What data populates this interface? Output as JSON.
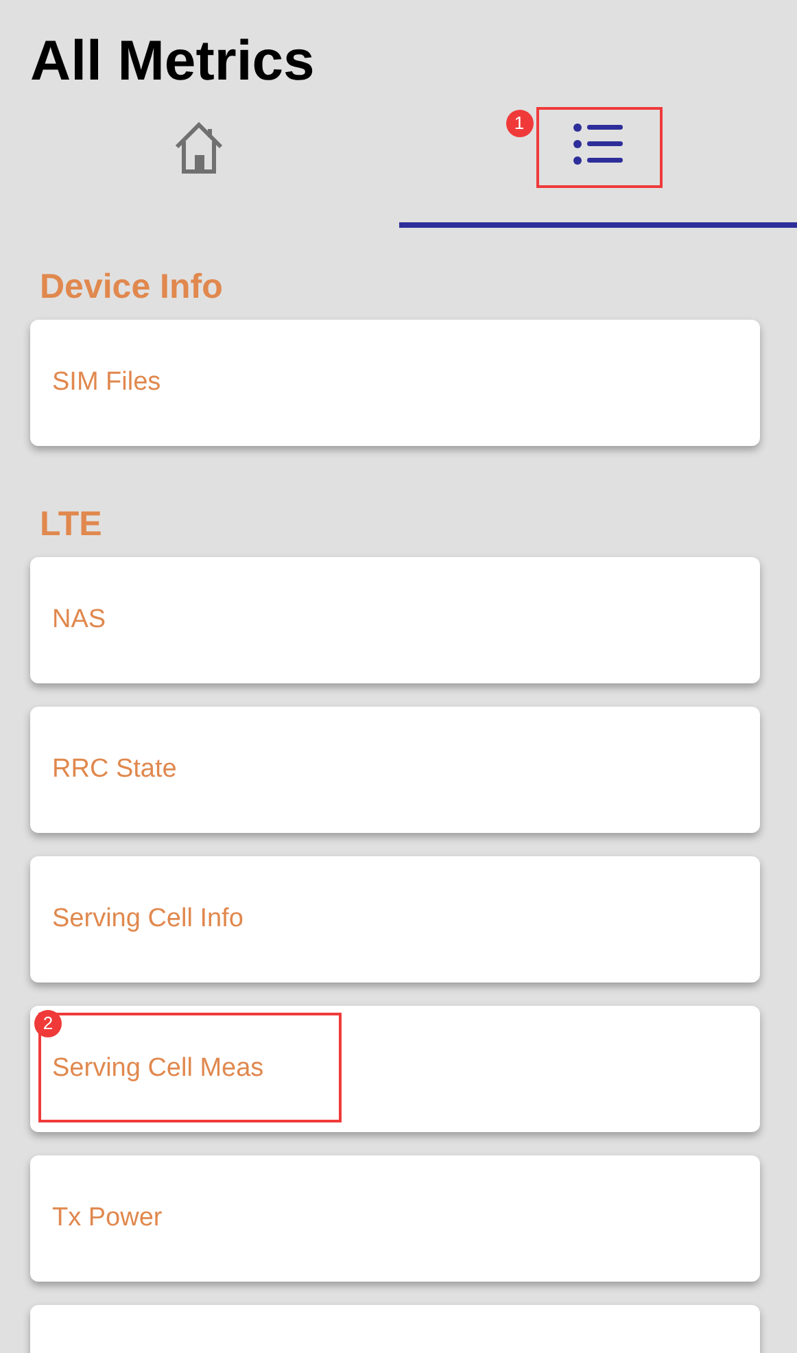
{
  "title": "All Metrics",
  "tabs": [
    {
      "kind": "home",
      "selected": false
    },
    {
      "kind": "list",
      "selected": true,
      "annotation": "1"
    }
  ],
  "sections": [
    {
      "title": "Device Info",
      "items": [
        {
          "label": "SIM Files"
        }
      ]
    },
    {
      "title": "LTE",
      "items": [
        {
          "label": "NAS"
        },
        {
          "label": "RRC State"
        },
        {
          "label": "Serving Cell Info"
        },
        {
          "label": "Serving Cell Meas",
          "annotation": "2"
        },
        {
          "label": "Tx Power"
        }
      ]
    }
  ]
}
